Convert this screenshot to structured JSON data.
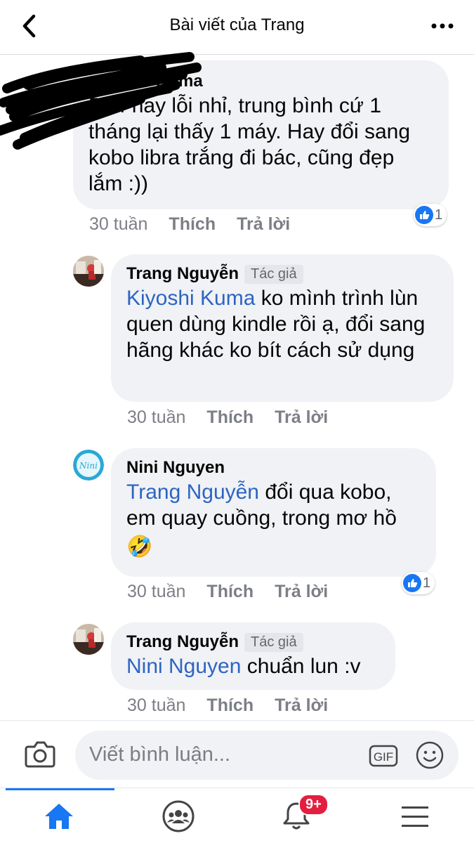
{
  "header": {
    "title": "Bài viết của Trang"
  },
  "comments": [
    {
      "author": "Kiyoshi Kuma",
      "author_visible": "oshi Kuma",
      "text": "Pp4 hay lỗi nhỉ, trung bình cứ 1 tháng lại thấy 1 máy. Hay đổi sang kobo libra trắng đi bác, cũng đẹp lắm :))",
      "time": "30 tuần",
      "like_label": "Thích",
      "reply_label": "Trả lời",
      "reaction_count": "1"
    },
    {
      "author": "Trang Nguyễn",
      "badge": "Tác giả",
      "mention": "Kiyoshi Kuma",
      "text": " ko mình trình lùn quen dùng kindle rồi ạ, đổi sang hãng khác ko bít cách sử dụng",
      "time": "30 tuần",
      "like_label": "Thích",
      "reply_label": "Trả lời"
    },
    {
      "author": "Nini Nguyen",
      "mention": "Trang Nguyễn",
      "text": " đổi qua kobo, em quay cuồng, trong mơ hồ",
      "emoji": "🤣",
      "time": "30 tuần",
      "like_label": "Thích",
      "reply_label": "Trả lời",
      "reaction_count": "1"
    },
    {
      "author": "Trang Nguyễn",
      "badge": "Tác giả",
      "mention": "Nini Nguyen",
      "text": " chuẩn lun :v",
      "time": "30 tuần",
      "like_label": "Thích",
      "reply_label": "Trả lời"
    }
  ],
  "composer": {
    "placeholder": "Viết bình luận...",
    "gif_label": "GIF"
  },
  "nav": {
    "notification_badge": "9+",
    "active_tab": "home"
  },
  "colors": {
    "accent": "#1877f2",
    "mention": "#2d64c3",
    "bubble": "#f0f2f5",
    "badge_red": "#e41e3f"
  },
  "icons": [
    "back-icon",
    "more-icon",
    "like-icon",
    "camera-icon",
    "gif-icon",
    "emoji-icon",
    "home-icon",
    "groups-icon",
    "bell-icon",
    "menu-icon"
  ]
}
